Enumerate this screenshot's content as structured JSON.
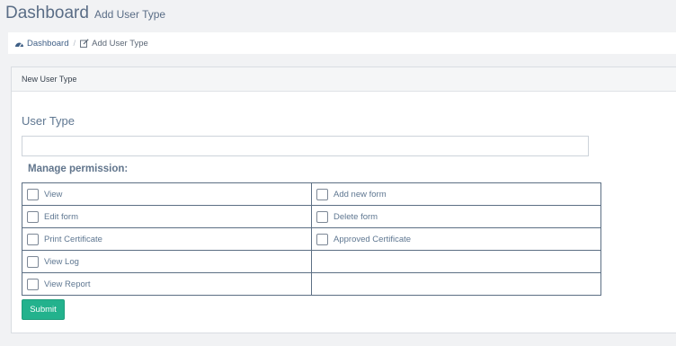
{
  "header": {
    "title": "Dashboard",
    "subtitle": "Add User Type"
  },
  "breadcrumb": [
    {
      "label": "Dashboard",
      "icon": "dashboard-icon"
    },
    {
      "label": "Add User Type",
      "icon": "edit-icon"
    }
  ],
  "card": {
    "title": "New User Type",
    "user_type_label": "User Type",
    "user_type_value": "",
    "permission_heading": "Manage permission:",
    "permissions": [
      {
        "left": "View",
        "right": "Add new form"
      },
      {
        "left": "Edit form",
        "right": "Delete form"
      },
      {
        "left": "Print Certificate",
        "right": "Approved Certificate"
      },
      {
        "left": "View Log",
        "right": ""
      },
      {
        "left": "View Report",
        "right": ""
      }
    ],
    "submit_label": "Submit"
  },
  "colors": {
    "submit_bg": "#23b28d",
    "page_bg": "#f1f2f4",
    "table_border": "#5c6f84"
  }
}
